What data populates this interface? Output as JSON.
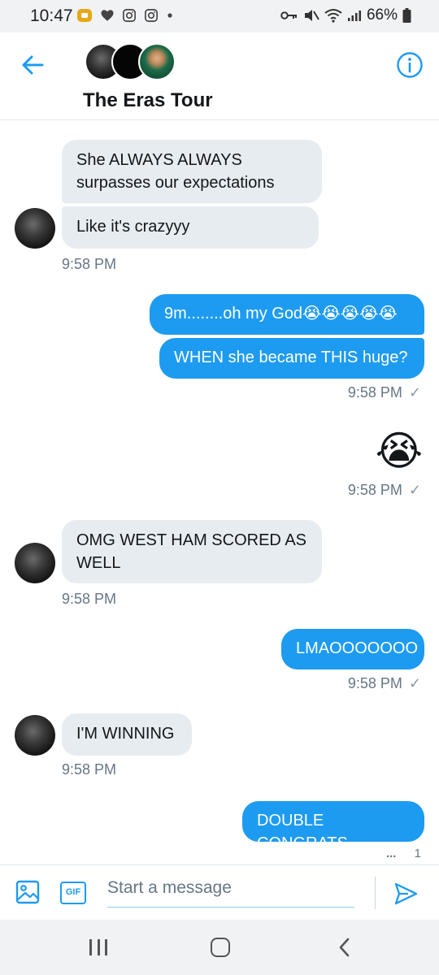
{
  "status_bar": {
    "time": "10:47",
    "battery": "66%"
  },
  "header": {
    "title": "The Eras Tour",
    "back_icon": "arrow-left-icon",
    "info_icon": "info-icon"
  },
  "messages": [
    {
      "type": "received",
      "text_lines": [
        "She ALWAYS ALWAYS",
        "surpasses our expectations"
      ]
    },
    {
      "type": "received",
      "text": "Like it's crazyyy"
    },
    {
      "type": "time",
      "text": "9:58 PM"
    },
    {
      "type": "sent",
      "text": "9m........oh my God😭😭😭😭😭"
    },
    {
      "type": "sent",
      "text": "WHEN she became THIS huge?"
    },
    {
      "type": "time",
      "text": "9:58 PM"
    },
    {
      "type": "sent_emoji",
      "text": "😭"
    },
    {
      "type": "time",
      "text": "9:58 PM"
    },
    {
      "type": "received",
      "text_lines": [
        "OMG WEST HAM SCORED AS",
        "WELL"
      ]
    },
    {
      "type": "time",
      "text": "9:58 PM"
    },
    {
      "type": "sent",
      "text": "LMAOOOOOOO"
    },
    {
      "type": "time",
      "text": "9:58 PM"
    },
    {
      "type": "received",
      "text": "I'M WINNING"
    },
    {
      "type": "time",
      "text": "9:58 PM"
    },
    {
      "type": "sent",
      "text": "DOUBLE CONGRATS"
    }
  ],
  "read_indicator": {
    "dots": "...",
    "count": "1"
  },
  "composer": {
    "placeholder": "Start a message",
    "gif_label": "GIF"
  },
  "colors": {
    "accent": "#1d9bf0",
    "received_bubble": "#e6ecf0",
    "time_text": "#657786"
  }
}
